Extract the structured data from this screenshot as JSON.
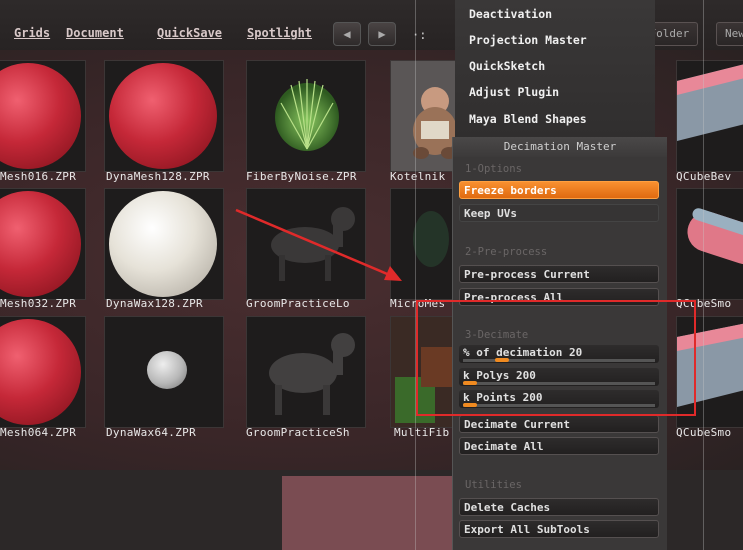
{
  "menubar": {
    "items": [
      "Grids",
      "Document",
      "QuickSave",
      "Spotlight"
    ],
    "buttons": [
      "Fo",
      "New Folder",
      "New"
    ]
  },
  "plugin_menu": {
    "items": [
      "Deactivation",
      "Projection Master",
      "QuickSketch",
      "Adjust Plugin",
      "Maya Blend Shapes"
    ]
  },
  "thumbnails": [
    {
      "label": "Mesh016.ZPR"
    },
    {
      "label": "DynaMesh128.ZPR"
    },
    {
      "label": "FiberByNoise.ZPR"
    },
    {
      "label": "Kotelnik"
    },
    {
      "label": "QCubeBev"
    },
    {
      "label": "Mesh032.ZPR"
    },
    {
      "label": "DynaWax128.ZPR"
    },
    {
      "label": "GroomPracticeLo"
    },
    {
      "label": "MicroMes"
    },
    {
      "label": "QCubeSmo"
    },
    {
      "label": "Mesh064.ZPR"
    },
    {
      "label": "DynaWax64.ZPR"
    },
    {
      "label": "GroomPracticeSh"
    },
    {
      "label": "MultiFib"
    },
    {
      "label": "QCubeSmo"
    }
  ],
  "decimation_master": {
    "title": "Decimation Master",
    "section_options": "1-Options",
    "freeze_borders": "Freeze borders",
    "keep_uvs": "Keep UVs",
    "section_preprocess": "2-Pre-process",
    "preprocess_current": "Pre-process Current",
    "preprocess_all": "Pre-process All",
    "section_decimate": "3-Decimate",
    "pct_decimation": {
      "label": "% of decimation",
      "value": "20"
    },
    "k_polys": {
      "label": "k Polys",
      "value": "200"
    },
    "k_points": {
      "label": "k Points",
      "value": "200"
    },
    "decimate_current": "Decimate Current",
    "decimate_all": "Decimate All",
    "section_utilities": "Utilities",
    "delete_caches": "Delete Caches",
    "export_all": "Export All SubTools"
  },
  "colors": {
    "accent_orange": "#f08a20",
    "annotation_red": "#e02a2a"
  }
}
